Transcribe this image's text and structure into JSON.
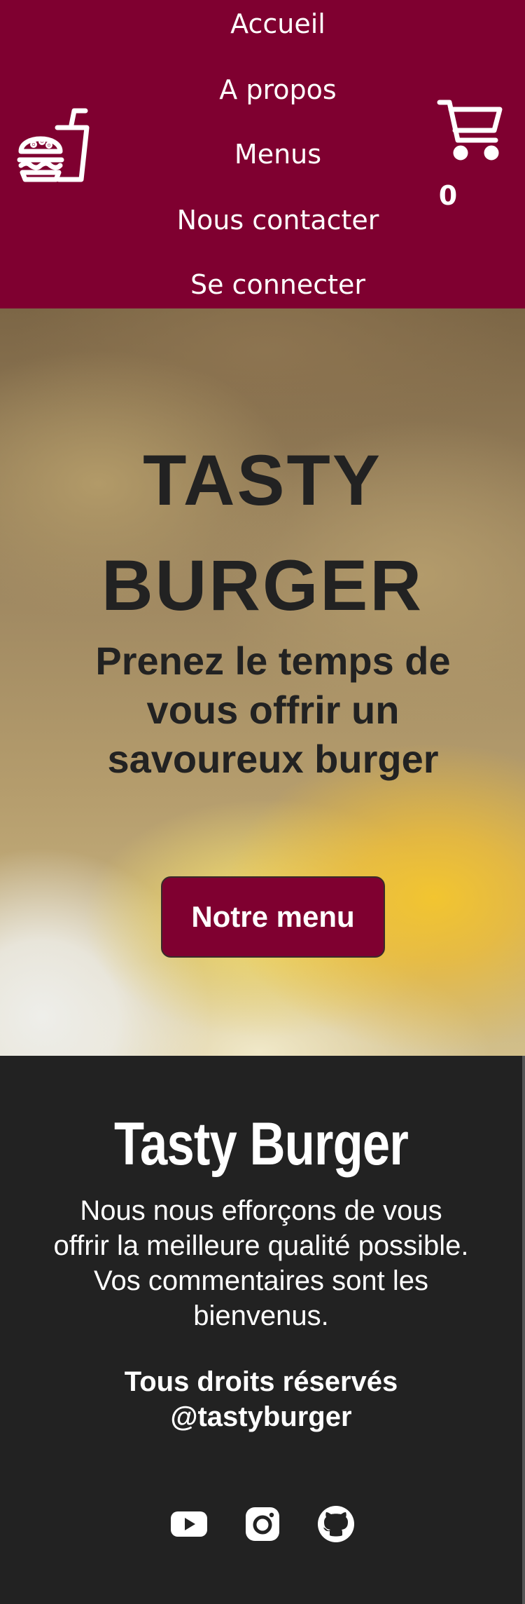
{
  "header": {
    "logo_icon": "burger-and-drink-icon",
    "nav": [
      {
        "label": "Accueil"
      },
      {
        "label": "A propos"
      },
      {
        "label": "Menus"
      },
      {
        "label": "Nous contacter"
      },
      {
        "label": "Se connecter"
      }
    ],
    "cart": {
      "icon": "cart-icon",
      "count": "0"
    }
  },
  "hero": {
    "title": "TASTY BURGER",
    "subtitle": "Prenez le temps de vous offrir un savoureux burger",
    "button_label": "Notre menu"
  },
  "footer": {
    "brand": "Tasty Burger",
    "text": "Nous nous efforçons de vous offrir la meilleure qualité possible. Vos commentaires sont les bienvenus.",
    "rights": "Tous droits réservés @tastyburger",
    "social": [
      {
        "icon": "youtube-icon"
      },
      {
        "icon": "instagram-icon"
      },
      {
        "icon": "github-icon"
      }
    ]
  },
  "colors": {
    "brand": "#7f0030",
    "footer_bg": "#222222",
    "hero_text": "#222222",
    "white": "#ffffff"
  }
}
